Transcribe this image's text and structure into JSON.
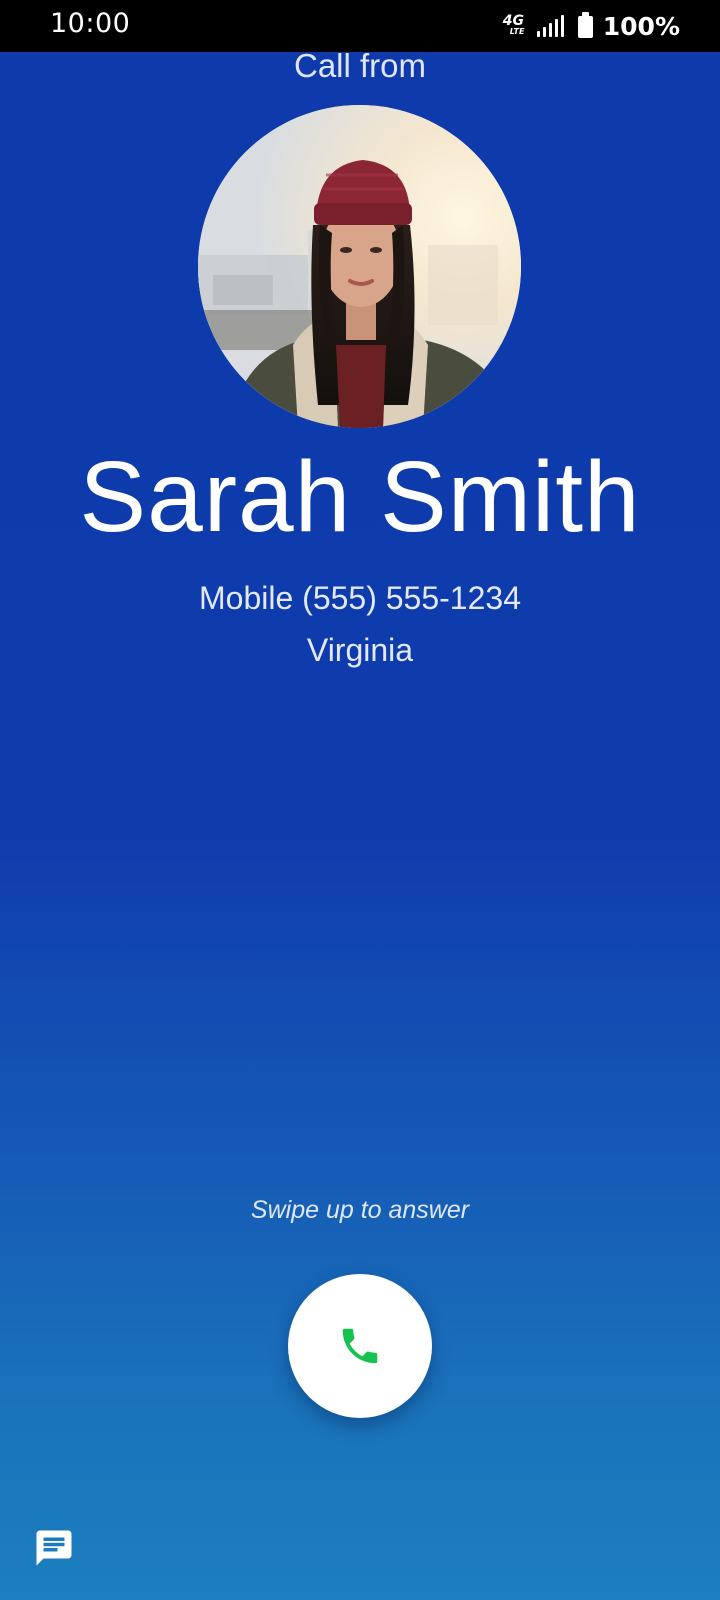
{
  "status_bar": {
    "time": "10:00",
    "network": "4G",
    "network_sub": "LTE",
    "battery": "100%",
    "signal_icon": "signal-bars-icon",
    "battery_icon": "battery-full-icon"
  },
  "call": {
    "header": "Call from",
    "caller_name": "Sarah Smith",
    "caller_number": "Mobile (555) 555-1234",
    "caller_location": "Virginia",
    "swipe_hint": "Swipe up to answer",
    "answer_icon": "phone-icon",
    "message_icon": "message-icon"
  },
  "colors": {
    "background_top": "#0e3aab",
    "background_bottom": "#1c7fbf",
    "answer_icon": "#16c24f",
    "status_bar": "#000000"
  }
}
